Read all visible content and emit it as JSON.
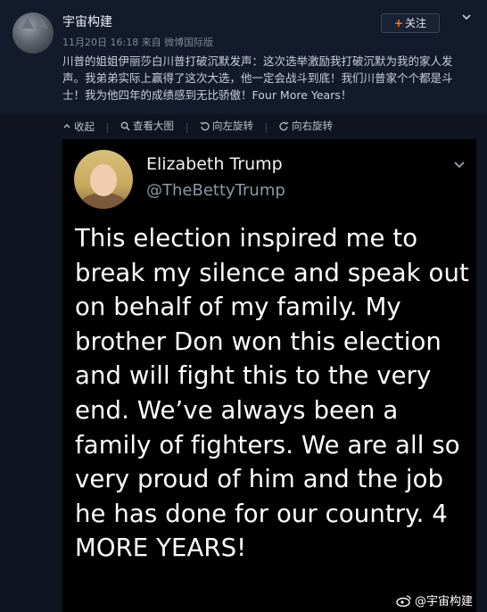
{
  "post": {
    "username": "宇宙构建",
    "meta": "11月20日 16:18 来自 微博国际版",
    "follow_label": "关注",
    "text": "川普的姐姐伊丽莎白川普打破沉默发声：这次选举激励我打破沉默为我的家人发声。我弟弟实际上赢得了这次大选，他一定会战斗到底！我们川普家个个都是斗士！我为他四年的成绩感到无比骄傲！Four More Years！"
  },
  "toolbar": {
    "collapse": "收起",
    "view_large": "查看大图",
    "rotate_left": "向左旋转",
    "rotate_right": "向右旋转"
  },
  "tweet": {
    "name": "Elizabeth Trump",
    "handle": "@TheBettyTrump",
    "body": "This election inspired me to break my silence and speak out on behalf of my family. My brother Don won this election and will fight this to the very end. We’ve always been a family of fighters. We are all so very proud of him and the job he has done for our country. 4 MORE YEARS!"
  },
  "watermark": {
    "text": "@宇宙构建"
  },
  "colors": {
    "accent_orange": "#ff7a1f",
    "background": "#0f1420",
    "card": "#000000"
  }
}
